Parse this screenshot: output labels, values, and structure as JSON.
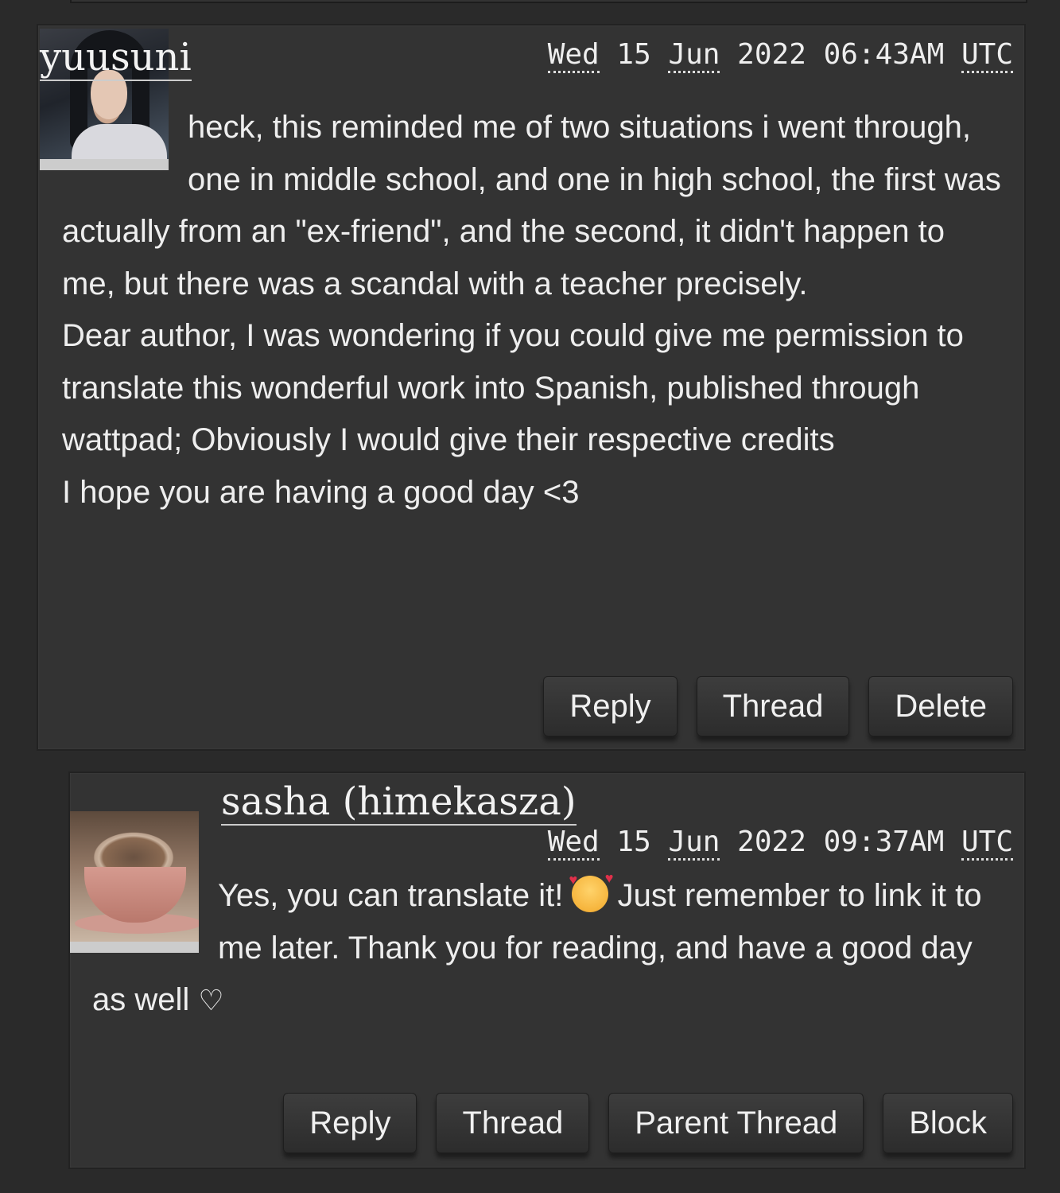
{
  "comments": [
    {
      "username": "yuusuni",
      "timestamp": {
        "day": "Wed",
        "date": "15",
        "month": "Jun",
        "year": "2022",
        "time": "06:43AM",
        "tz": "UTC"
      },
      "avatar_icon": "portrait-avatar",
      "paragraphs": [
        "heck, this reminded me of two situations i went through, one in middle school, and one in high school, the first was actually from an \"ex-friend\", and the second, it didn't happen to me, but there was a scandal with a teacher precisely.",
        "Dear author, I was wondering if you could give me permission to translate this wonderful work into Spanish, published through wattpad; Obviously I would give their respective credits",
        "I hope you are having a good day <3"
      ],
      "actions": [
        "Reply",
        "Thread",
        "Delete"
      ]
    },
    {
      "username": "sasha (himekasza)",
      "timestamp": {
        "day": "Wed",
        "date": "15",
        "month": "Jun",
        "year": "2022",
        "time": "09:37AM",
        "tz": "UTC"
      },
      "avatar_icon": "coffee-cup-avatar",
      "text_before_emoji": "Yes, you can translate it! ",
      "emoji": "smiling-face-with-hearts",
      "text_after_emoji": " Just remember to link it to me later. Thank you for reading, and have a good day as well ",
      "heart": "♡",
      "actions": [
        "Reply",
        "Thread",
        "Parent Thread",
        "Block"
      ]
    }
  ],
  "colors": {
    "background": "#2a2a2a",
    "panel": "#333333",
    "text": "#eeeeee",
    "button": "#363636"
  }
}
